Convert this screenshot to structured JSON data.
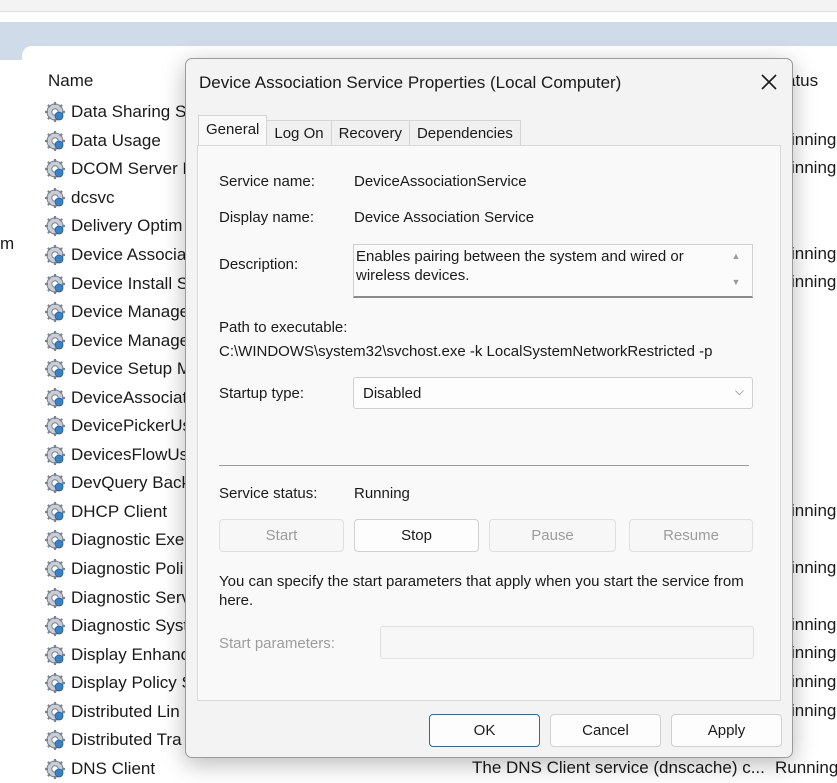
{
  "background": {
    "left_fragment": "m",
    "columns": {
      "name": "Name",
      "status": "atus"
    },
    "services": [
      {
        "name": "Data Sharing S",
        "status": ""
      },
      {
        "name": "Data Usage",
        "status": "inning"
      },
      {
        "name": "DCOM Server P",
        "status": "inning"
      },
      {
        "name": "dcsvc",
        "status": ""
      },
      {
        "name": "Delivery Optim",
        "status": ""
      },
      {
        "name": "Device Associa",
        "status": "inning"
      },
      {
        "name": "Device Install S",
        "status": "inning"
      },
      {
        "name": "Device Manage",
        "status": ""
      },
      {
        "name": "Device Manage",
        "status": ""
      },
      {
        "name": "Device Setup M",
        "status": ""
      },
      {
        "name": "DeviceAssociat",
        "status": ""
      },
      {
        "name": "DevicePickerUs",
        "status": ""
      },
      {
        "name": "DevicesFlowUs",
        "status": ""
      },
      {
        "name": "DevQuery Back",
        "status": ""
      },
      {
        "name": "DHCP Client",
        "status": "inning"
      },
      {
        "name": "Diagnostic Exe",
        "status": ""
      },
      {
        "name": "Diagnostic Poli",
        "status": "inning"
      },
      {
        "name": "Diagnostic Serv",
        "status": ""
      },
      {
        "name": "Diagnostic Syst",
        "status": "inning"
      },
      {
        "name": "Display Enhanc",
        "status": "inning"
      },
      {
        "name": "Display Policy S",
        "status": "inning"
      },
      {
        "name": "Distributed Lin",
        "status": "inning"
      },
      {
        "name": "Distributed Tra",
        "status": ""
      },
      {
        "name": "DNS Client",
        "status": ""
      }
    ],
    "dns_description": "The DNS Client service (dnscache) c...",
    "dns_status": "Running"
  },
  "dialog": {
    "title": "Device Association Service Properties (Local Computer)",
    "tabs": [
      "General",
      "Log On",
      "Recovery",
      "Dependencies"
    ],
    "service_name_label": "Service name:",
    "service_name_value": "DeviceAssociationService",
    "display_name_label": "Display name:",
    "display_name_value": "Device Association Service",
    "description_label": "Description:",
    "description_value": "Enables pairing between the system and wired or wireless devices.",
    "path_label": "Path to executable:",
    "path_value": "C:\\WINDOWS\\system32\\svchost.exe -k LocalSystemNetworkRestricted -p",
    "startup_label": "Startup type:",
    "startup_value": "Disabled",
    "status_label": "Service status:",
    "status_value": "Running",
    "buttons": {
      "start": "Start",
      "stop": "Stop",
      "pause": "Pause",
      "resume": "Resume"
    },
    "params_hint": "You can specify the start parameters that apply when you start the service from here.",
    "params_label": "Start parameters:",
    "footer": {
      "ok": "OK",
      "cancel": "Cancel",
      "apply": "Apply"
    }
  }
}
